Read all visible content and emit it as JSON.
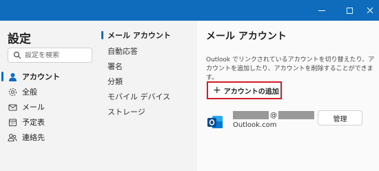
{
  "titlebar": {
    "minimize_glyph": "—",
    "maximize_glyph": "☐",
    "close_glyph": "✕"
  },
  "sidebar": {
    "title": "設定",
    "search_placeholder": "設定を検索",
    "items": [
      {
        "label": "アカウント",
        "icon": "person-icon",
        "active": true
      },
      {
        "label": "全般",
        "icon": "gear-icon",
        "active": false
      },
      {
        "label": "メール",
        "icon": "mail-icon",
        "active": false
      },
      {
        "label": "予定表",
        "icon": "calendar-icon",
        "active": false
      },
      {
        "label": "連絡先",
        "icon": "contacts-icon",
        "active": false
      }
    ]
  },
  "subnav": {
    "items": [
      {
        "label": "メール アカウント",
        "active": true
      },
      {
        "label": "自動応答",
        "active": false
      },
      {
        "label": "署名",
        "active": false
      },
      {
        "label": "分類",
        "active": false
      },
      {
        "label": "モバイル デバイス",
        "active": false
      },
      {
        "label": "ストレージ",
        "active": false
      }
    ]
  },
  "main": {
    "title": "メール アカウント",
    "description": "Outlook でリンクされているアカウントを切り替えたり、アカウントを追加したり、アカウントを削除することができます。",
    "add_account_label": "アカウントの追加",
    "account": {
      "at_sign": "@",
      "type": "Outlook.com",
      "manage_label": "管理"
    }
  },
  "colors": {
    "accent": "#0f6cbd",
    "highlight_border": "#d01f28"
  }
}
